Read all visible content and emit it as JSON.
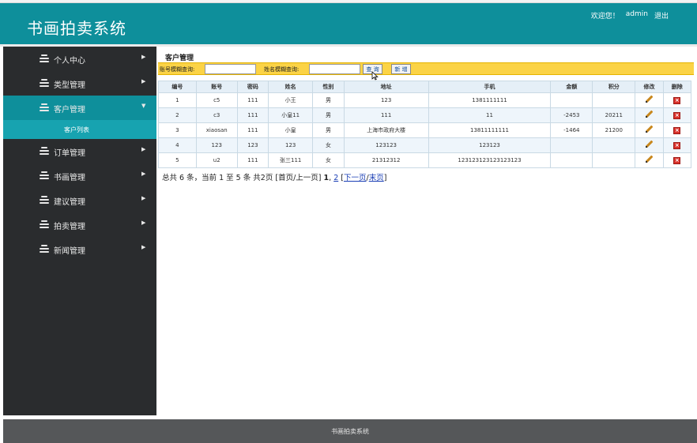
{
  "header": {
    "brand": "书画拍卖系统",
    "welcome": "欢迎您！",
    "username": "admin",
    "logout": "退出"
  },
  "sidebar": {
    "items": [
      {
        "label": "个人中心"
      },
      {
        "label": "类型管理"
      },
      {
        "label": "客户管理"
      },
      {
        "label": "订单管理"
      },
      {
        "label": "书画管理"
      },
      {
        "label": "建议管理"
      },
      {
        "label": "拍卖管理"
      },
      {
        "label": "新闻管理"
      }
    ],
    "sub_item": "客户列表"
  },
  "content": {
    "title": "客户管理",
    "search": {
      "account_label": "账号模糊查询:",
      "name_label": "姓名模糊查询:",
      "account_value": "",
      "name_value": "",
      "query_button": "查 询",
      "add_button": "新 增"
    },
    "table": {
      "headers": [
        "编号",
        "账号",
        "密码",
        "姓名",
        "性别",
        "地址",
        "手机",
        "金额",
        "积分",
        "修改",
        "删除"
      ],
      "rows": [
        {
          "id": "1",
          "account": "c5",
          "password": "111",
          "name": "小王",
          "gender": "男",
          "address": "123",
          "phone": "1381111111",
          "amount": "",
          "points": ""
        },
        {
          "id": "2",
          "account": "c3",
          "password": "111",
          "name": "小皇11",
          "gender": "男",
          "address": "111",
          "phone": "11",
          "amount": "-2453",
          "points": "20211"
        },
        {
          "id": "3",
          "account": "xiaosan",
          "password": "111",
          "name": "小皇",
          "gender": "男",
          "address": "上海市政府大楼",
          "phone": "13811111111",
          "amount": "-1464",
          "points": "21200"
        },
        {
          "id": "4",
          "account": "123",
          "password": "123",
          "name": "123",
          "gender": "女",
          "address": "123123",
          "phone": "123123",
          "amount": "",
          "points": ""
        },
        {
          "id": "5",
          "account": "u2",
          "password": "111",
          "name": "张三111",
          "gender": "女",
          "address": "21312312",
          "phone": "123123123123123123",
          "amount": "",
          "points": ""
        }
      ]
    },
    "pager": {
      "summary": "总共 6 条，当前 1 至 5 条 共2页",
      "first_prev": "[首页/上一页]",
      "page1": "1",
      "page2": "2",
      "next": "下一页",
      "slash": "/",
      "last": "末页",
      "lbracket": "[",
      "rbracket": "]"
    }
  },
  "footer": {
    "text": "书画拍卖系统"
  }
}
